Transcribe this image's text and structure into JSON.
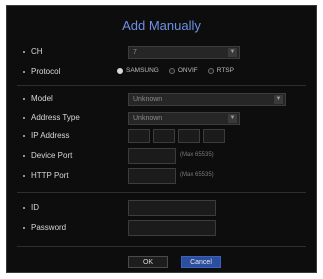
{
  "dialog": {
    "title": "Add Manually"
  },
  "ch": {
    "label": "CH",
    "value": "7"
  },
  "protocol": {
    "label": "Protocol",
    "options": [
      {
        "label": "SAMSUNG",
        "selected": true
      },
      {
        "label": "ONVIF",
        "selected": false
      },
      {
        "label": "RTSP",
        "selected": false
      }
    ]
  },
  "model": {
    "label": "Model",
    "value": "Unknown"
  },
  "address_type": {
    "label": "Address Type",
    "value": "Unknown"
  },
  "ip_address": {
    "label": "IP Address"
  },
  "device_port": {
    "label": "Device Port",
    "hint": "(Max 65535)"
  },
  "http_port": {
    "label": "HTTP Port",
    "hint": "(Max 65535)"
  },
  "id": {
    "label": "ID"
  },
  "password": {
    "label": "Password"
  },
  "buttons": {
    "ok": "OK",
    "cancel": "Cancel"
  },
  "colors": {
    "background": "#0d0d0d",
    "title": "#6f8fe6",
    "primary_button": "#2c4e9c"
  }
}
